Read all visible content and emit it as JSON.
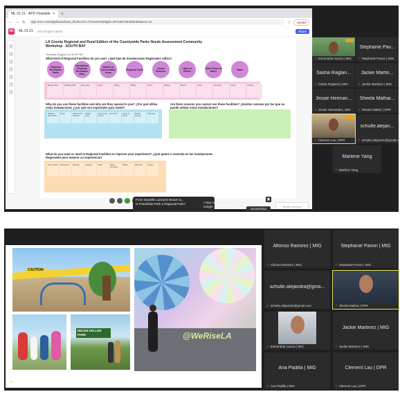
{
  "meeting_top": {
    "browser": {
      "tab_title": "ML.01.21 - APD Flowable",
      "url": "app.miro.com/app/board/o9J_lhUbcuT4=/?moveToWidget=3074457354692460&cot=14",
      "update_label": "Update",
      "board_title": "ML.01.21",
      "changes_label": "All changes saved",
      "share_label": "Share"
    },
    "board": {
      "title": "LA County Regional and Rural Edition of the Countywide Parks Needs Assessment Community Workshop - SOUTH BAY",
      "date": "Tuesday, August 24 | 6:00 PM",
      "q1": "What kind of Regional Facilities do you use? ¿Qué tipo de instalaciones Regionales utiliza?",
      "facilities": [
        "Regional Recreation Parks",
        "Specialized Regional Recreation Sites",
        "Natural or Conservation Areas",
        "Regional Trails",
        "Ocean Beaches",
        "Lakes or Rivers",
        "Parks Close to Home",
        "Other"
      ],
      "q2": "Why do you use these facilities and why are they special to you? ¿Por qué utiliza estas instalaciones y por qué son especiales para usted?",
      "q3": "Are there reasons you cannot use these facilities? ¿Existen razones por las que no puede utilizar estas instalaciones?",
      "q4": "What do you want or need at Regional Facilities to improve your experience? ¿Qué quiere o necesita en las instalaciones Regionales para mejorar su experiencia?",
      "stickies_pink": [
        "Beach cities",
        "Walking trails",
        "Dog parks",
        "Lakes",
        "Hiking",
        "Biking",
        "Picnic",
        "Birding",
        "Beach",
        "Trails",
        "Camping",
        "Sports",
        "Fishing"
      ],
      "stickies_blue": [
        "Walking with family",
        "Quiet",
        "Nature and fresh air",
        "Shade trees",
        "Community events",
        "Exercise",
        "Close to home",
        "Beach access",
        "Kids play"
      ],
      "stickies_orange": [
        "More shade",
        "Restrooms",
        "Parking",
        "Lighting",
        "Trails",
        "Water fountains",
        "Safety",
        "Benches",
        "Access"
      ],
      "minimap_label": "Board minimap"
    },
    "chat_popup": {
      "from": "From Danielle Lazzarini Brown to...",
      "message": "Is Friendship Park a Regional Park?"
    },
    "caption": "I says regional Parks a lot rmed tonight. If you have to drive to...",
    "screenshot_label": "Screenshot",
    "participants": [
      {
        "name": "Esmeralda Garcia | MIG",
        "video": true
      },
      {
        "name": "Stephanie Pav...",
        "label": "Stephanie Pavon | MIG"
      },
      {
        "name": "Sasha Raglan...",
        "label": "Sasha Ragland | MIG"
      },
      {
        "name": "Jackie Martin...",
        "label": "Jackie Martinez | MIG"
      },
      {
        "name": "Jessie Herman...",
        "label": "Jessie Hernandez, MIG"
      },
      {
        "name": "Sheela Mathai...",
        "label": "Sheela Mathai | DPR"
      },
      {
        "name": "Clement Lau | DPR",
        "video": true
      },
      {
        "name": "schulte.alejan...",
        "label": "schulte.alejandro@gmail.com"
      },
      {
        "name": "Marlene Yang",
        "label": "Marlene Yang"
      }
    ]
  },
  "meeting_bottom": {
    "slide": {
      "banner_text": "CAUTION",
      "park_sign": "HELEN KELLER PARK",
      "mural_text": "@WeRiseLA",
      "slide_number": "17"
    },
    "participants": [
      {
        "name": "Alfonso Ramirez | MIG",
        "label": "Alfonso Ramirez | MIG"
      },
      {
        "name": "Stephanie Pavon | MIG",
        "label": "Stephanie Pavon | MIG"
      },
      {
        "name": "schulte.alejandra@gma...",
        "label": "schulte.alejandra@gmail.com"
      },
      {
        "name": "",
        "label": "Sheela Mathai | DPR",
        "video": true
      },
      {
        "name": "",
        "label": "Esmeralda Garcia | MIG",
        "video": true
      },
      {
        "name": "Jackie Martinez | MIG",
        "label": "Jackie Martinez | MIG"
      },
      {
        "name": "Ana Padilla | MIG",
        "label": "Ana Padilla | MIG"
      },
      {
        "name": "Clement Lau | DPR",
        "label": "Clement Lau | DPR"
      }
    ]
  },
  "colors": {
    "circle": "#cf86d8",
    "pink": "#f6c5dd",
    "blue": "#b3e2f2",
    "green": "#c9f0b5",
    "orange": "#fcdcb2",
    "active_speaker": "#e7e35a"
  }
}
